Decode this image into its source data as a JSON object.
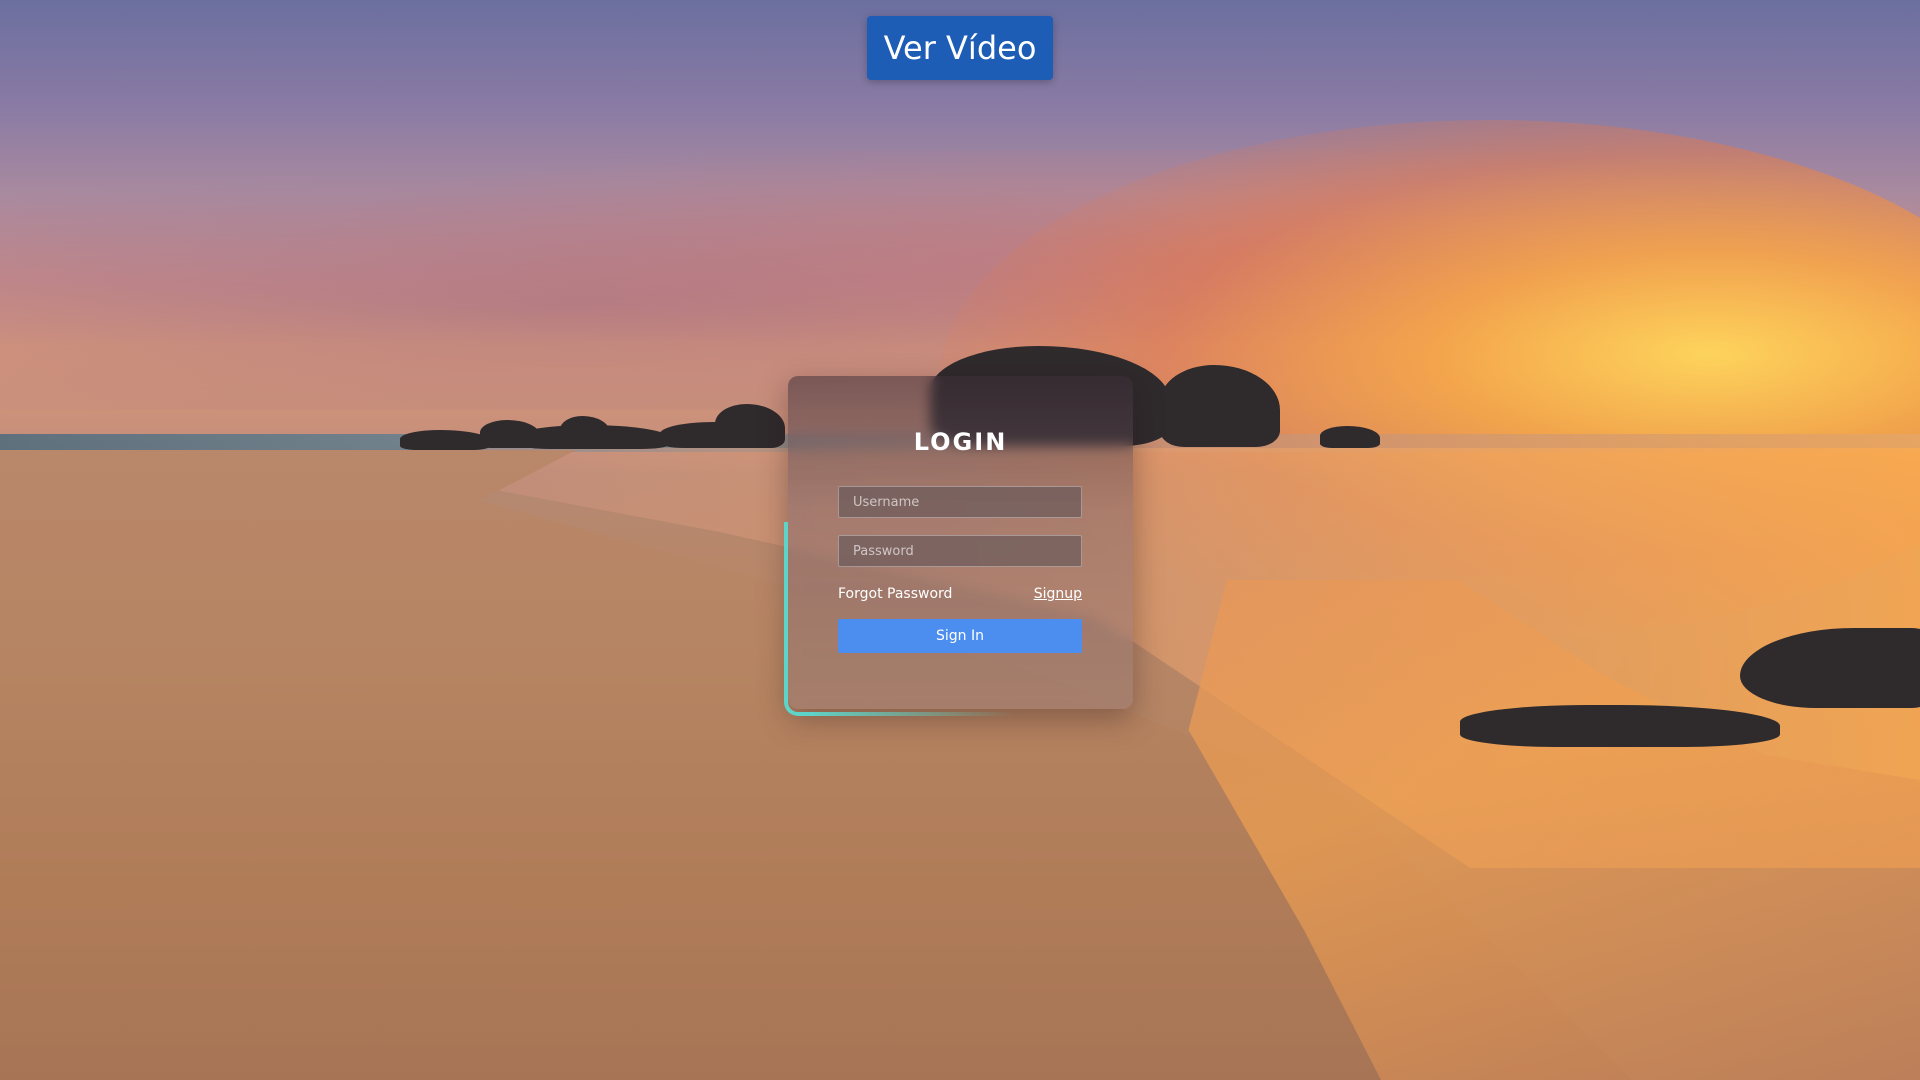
{
  "header": {
    "video_button_label": "Ver Vídeo"
  },
  "login": {
    "title": "LOGIN",
    "username_placeholder": "Username",
    "password_placeholder": "Password",
    "forgot_password_label": "Forgot Password",
    "signup_label": "Signup",
    "signin_label": "Sign In"
  },
  "colors": {
    "video_button": "#1e5db5",
    "signin_button": "#4b8ef0",
    "accent_border": "#5ed4c8"
  }
}
